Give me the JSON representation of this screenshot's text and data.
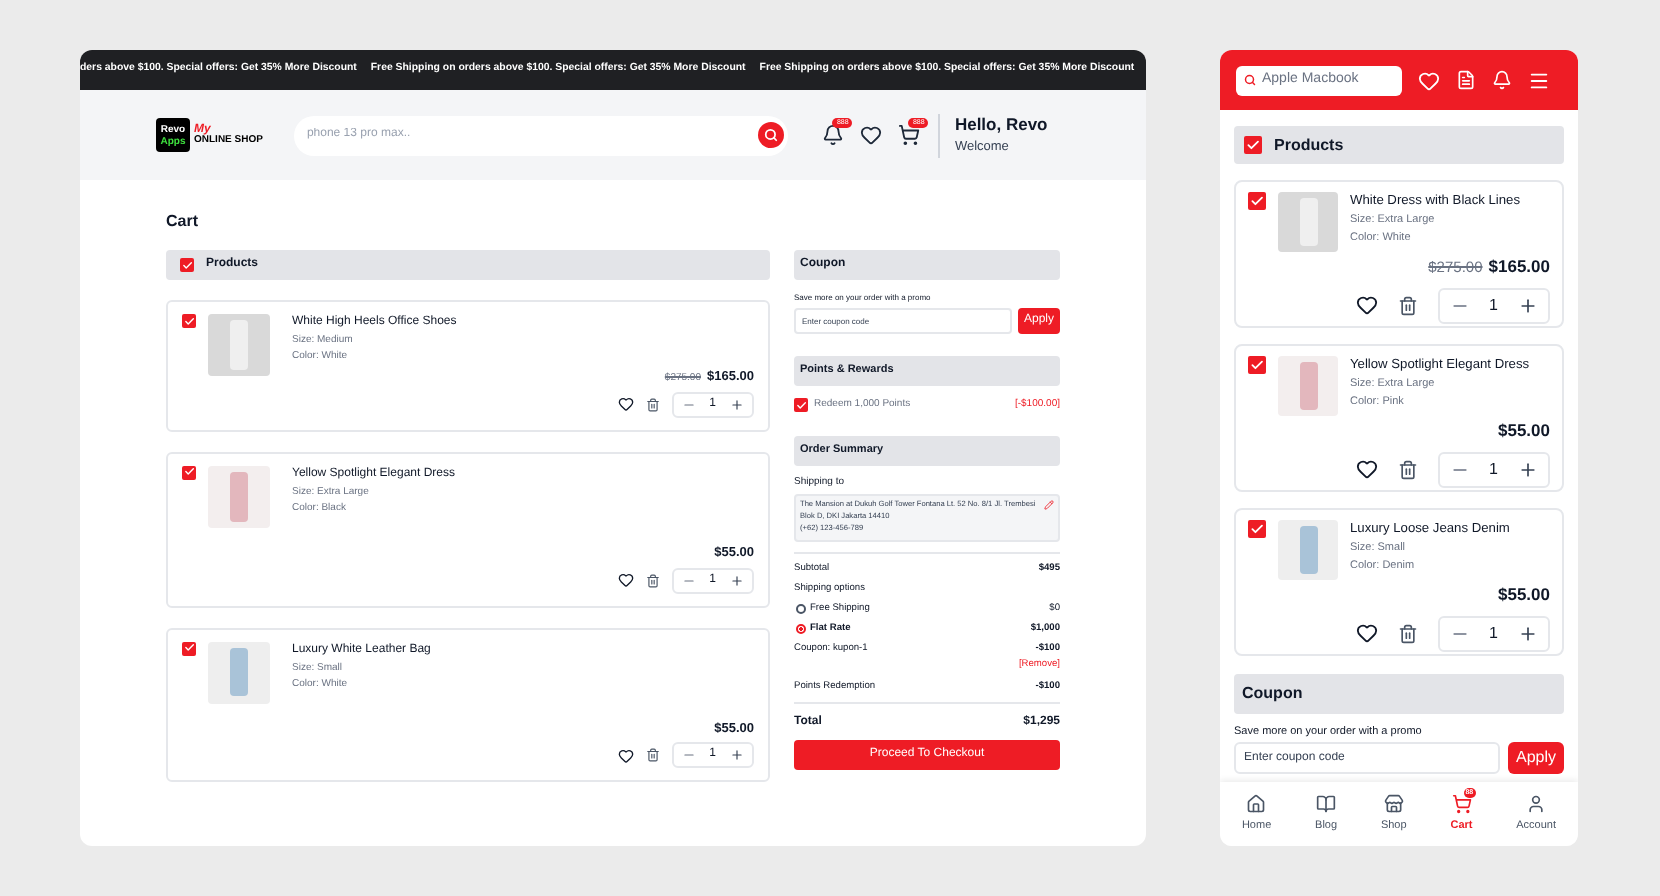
{
  "desktop": {
    "announcements": [
      "ders above $100. Special offers: Get 35% More Discount",
      "Free Shipping on orders above $100. Special offers: Get 35% More Discount",
      "Free Shipping on orders above $100. Special offers: Get 35% More Discount"
    ],
    "header": {
      "logo_top": "Revo",
      "logo_bottom": "Apps",
      "logo_script": "My",
      "logo_text": "ONLINE SHOP",
      "search": {
        "placeholder": "phone 13 pro max.."
      },
      "icons": [
        {
          "kind": "bell",
          "badge": "888"
        },
        {
          "kind": "heart"
        },
        {
          "kind": "cart",
          "badge": "888"
        }
      ],
      "greeting": "Hello, Revo",
      "subtitle": "Welcome"
    },
    "title": "Cart",
    "products_header": {
      "label": "Products",
      "checked": true
    },
    "items": [
      {
        "name": "White High Heels Office Shoes",
        "size": "Size: Medium",
        "color_text": "Color: White",
        "old_price": "$275.00",
        "price": "$165.00",
        "qty": "1",
        "checked": true,
        "kind": "shoes"
      },
      {
        "name": "Yellow Spotlight Elegant Dress",
        "size": "Size: Extra Large",
        "color_text": "Color: Black",
        "price": "$55.00",
        "qty": "1",
        "checked": true,
        "kind": "dress"
      },
      {
        "name": "Luxury White Leather Bag",
        "size": "Size: Small",
        "color_text": "Color: White",
        "price": "$55.00",
        "qty": "1",
        "checked": true,
        "kind": "jeans"
      }
    ],
    "coupon": {
      "title": "Coupon",
      "hint": "Save more on your order with a promo",
      "placeholder": "Enter coupon code",
      "button": "Apply"
    },
    "points": {
      "title": "Points & Rewards",
      "label": "Redeem 1,000 Points",
      "value": "[-$100.00]",
      "checked": true
    },
    "summary": {
      "title": "Order Summary",
      "shipping_label": "Shipping to",
      "address": "The Mansion at Dukuh Golf Tower Fontana Lt. 52 No. 8/1 Jl. Trembesi Blok D, DKI Jakarta 14410",
      "phone": "(+62) 123-456-789",
      "subtotal_label": "Subtotal",
      "subtotal": "$495",
      "shipping_options_label": "Shipping options",
      "options": [
        {
          "label": "Free Shipping",
          "value": "$0",
          "selected": false
        },
        {
          "label": "Flat Rate",
          "value": "$1,000",
          "selected": true
        }
      ],
      "coupon_label": "Coupon: kupon-1",
      "coupon_value": "-$100",
      "remove": "[Remove]",
      "points_label": "Points Redemption",
      "points_value": "-$100",
      "total_label": "Total",
      "total": "$1,295",
      "button": "Proceed To Checkout"
    }
  },
  "mobile": {
    "search": {
      "placeholder": "Apple Macbook"
    },
    "products_header": {
      "label": "Products",
      "checked": true
    },
    "items": [
      {
        "name": "White Dress with Black Lines",
        "size": "Size: Extra Large",
        "color_text": "Color: White",
        "old_price": "$275.00",
        "price": "$165.00",
        "qty": "1",
        "checked": true,
        "kind": "shoes"
      },
      {
        "name": "Yellow Spotlight Elegant Dress",
        "size": "Size: Extra Large",
        "color_text": "Color: Pink",
        "price": "$55.00",
        "qty": "1",
        "checked": true,
        "kind": "dress"
      },
      {
        "name": "Luxury Loose Jeans Denim",
        "size": "Size: Small",
        "color_text": "Color: Denim",
        "price": "$55.00",
        "qty": "1",
        "checked": true,
        "kind": "jeans"
      }
    ],
    "coupon": {
      "title": "Coupon",
      "hint": "Save more on your order with a promo",
      "placeholder": "Enter coupon code",
      "button": "Apply"
    },
    "nav": [
      {
        "kind": "home",
        "label": "Home",
        "selected": false
      },
      {
        "kind": "blog",
        "label": "Blog",
        "selected": false
      },
      {
        "kind": "shop",
        "label": "Shop",
        "selected": false
      },
      {
        "kind": "cart",
        "label": "Cart",
        "selected": true,
        "badge": "88"
      },
      {
        "kind": "account",
        "label": "Account",
        "selected": false
      }
    ]
  }
}
